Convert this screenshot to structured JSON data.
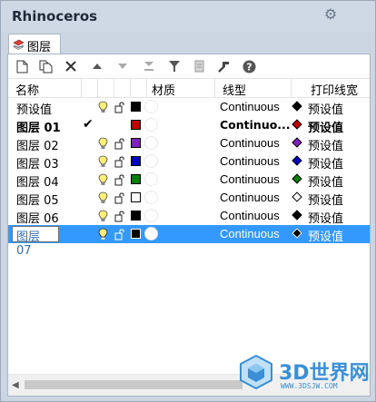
{
  "window": {
    "title": "Rhinoceros",
    "tab_label": "图层"
  },
  "toolbar": {
    "icons": [
      "new-layer-icon",
      "new-sublayer-icon",
      "delete-icon",
      "move-up-icon",
      "move-down-icon",
      "move-to-parent-icon",
      "filter-icon",
      "document-icon",
      "tools-icon",
      "help-icon"
    ]
  },
  "columns": {
    "name": "名称",
    "material": "材质",
    "linetype": "线型",
    "print_width": "打印线宽"
  },
  "layers": [
    {
      "name": "预设值",
      "current": false,
      "bold": false,
      "color": "#000000",
      "linetype": "Continuous",
      "print_color": "#000000",
      "print_width": "预设值"
    },
    {
      "name": "图层 01",
      "current": true,
      "bold": true,
      "check": "✔",
      "color": "#c00000",
      "linetype": "Continuo...",
      "print_color": "#c00000",
      "print_width": "预设值"
    },
    {
      "name": "图层 02",
      "current": false,
      "bold": false,
      "color": "#8020c0",
      "linetype": "Continuous",
      "print_color": "#8020c0",
      "print_width": "预设值"
    },
    {
      "name": "图层 03",
      "current": false,
      "bold": false,
      "color": "#0000c0",
      "linetype": "Continuous",
      "print_color": "#0000c0",
      "print_width": "预设值"
    },
    {
      "name": "图层 04",
      "current": false,
      "bold": false,
      "color": "#008000",
      "linetype": "Continuous",
      "print_color": "#008000",
      "print_width": "预设值"
    },
    {
      "name": "图层 05",
      "current": false,
      "bold": false,
      "color": "#ffffff",
      "linetype": "Continuous",
      "print_color": "#ffffff",
      "print_width": "预设值"
    },
    {
      "name": "图层 06",
      "current": false,
      "bold": false,
      "color": "#000000",
      "linetype": "Continuous",
      "print_color": "#000000",
      "print_width": "预设值"
    },
    {
      "name": "图层 07",
      "current": false,
      "bold": false,
      "selected": true,
      "editing": true,
      "color": "#000000",
      "linetype": "Continuous",
      "print_color": "#000000",
      "print_width": "预设值"
    }
  ],
  "watermark": {
    "title": "3D世界网",
    "url": "WWW.3DSJW.COM"
  },
  "colors": {
    "selection": "#3399ff",
    "panel_bg": "#ffffff",
    "window_bg": "#ccd6e3"
  }
}
